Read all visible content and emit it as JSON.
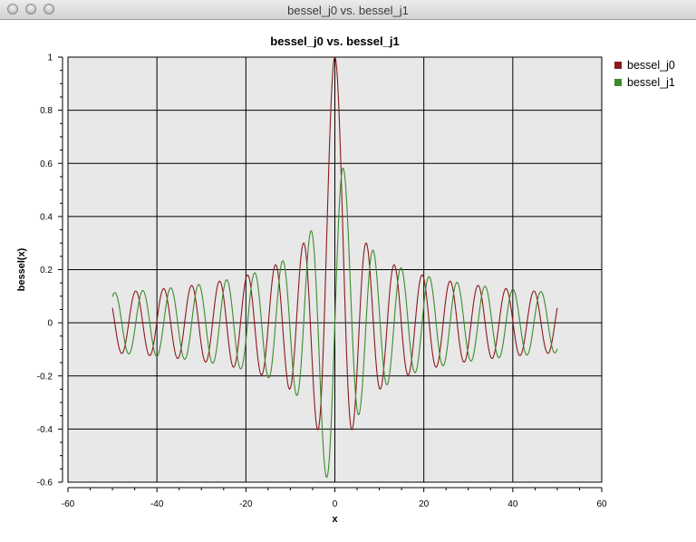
{
  "window": {
    "title": "bessel_j0 vs. bessel_j1"
  },
  "chart_data": {
    "type": "line",
    "title": "bessel_j0 vs. bessel_j1",
    "xlabel": "x",
    "ylabel": "bessel(x)",
    "xlim": [
      -60,
      60
    ],
    "ylim": [
      -0.6,
      1
    ],
    "xticks": [
      -60,
      -40,
      -20,
      0,
      20,
      40,
      60
    ],
    "yticks": [
      -0.6,
      -0.4,
      -0.2,
      0,
      0.2,
      0.4,
      0.6,
      0.8,
      1
    ],
    "grid": true,
    "legend_position": "right",
    "x_range": [
      -50,
      50
    ],
    "series": [
      {
        "name": "bessel_j0",
        "function": "j0",
        "color": "#8b1a1a"
      },
      {
        "name": "bessel_j1",
        "function": "j1",
        "color": "#3c8c2a"
      }
    ],
    "plot_background": "#e8e8e8"
  }
}
